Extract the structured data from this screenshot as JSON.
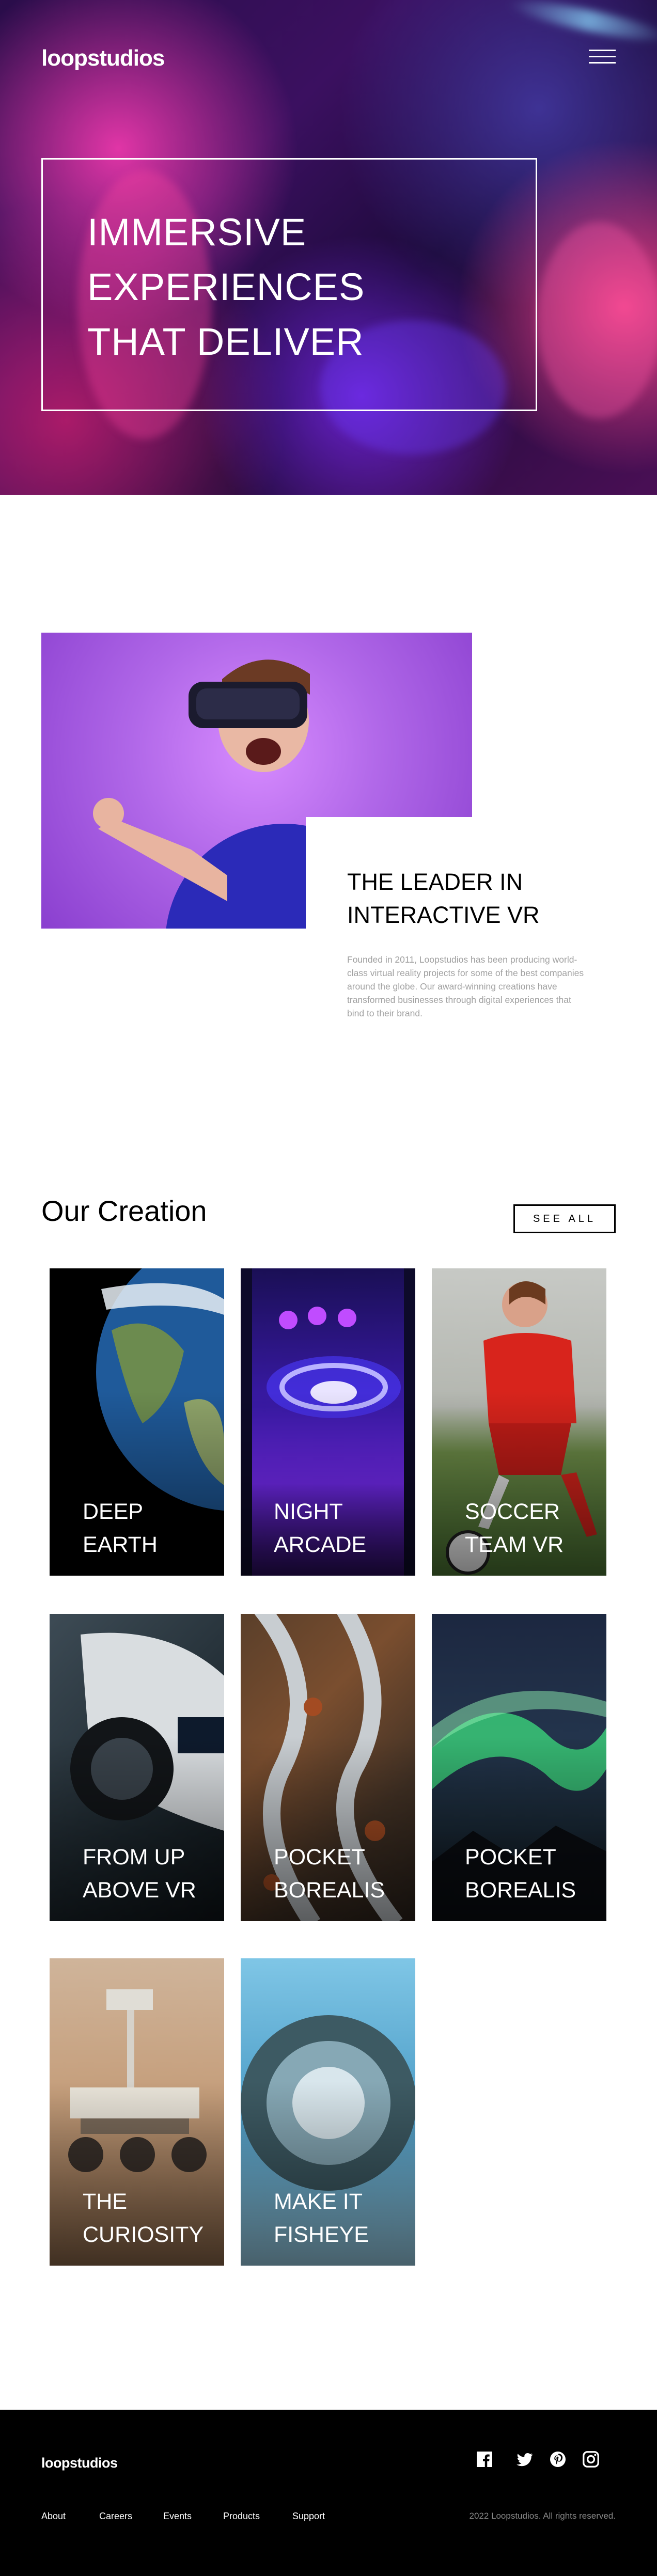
{
  "header": {
    "logo": "loopstudios",
    "menu_icon": "hamburger-menu-icon"
  },
  "hero": {
    "title": "Immersive experiences that deliver"
  },
  "interactive": {
    "title": "The leader in interactive VR",
    "text": "Founded in 2011, Loopstudios has been producing world-class virtual reality projects for some of the best companies around the globe. Our award-winning creations have transformed businesses through digital experiences that bind to their brand."
  },
  "creations": {
    "title": "Our Creation",
    "see_all": "See all",
    "items": [
      {
        "label": "Deep earth"
      },
      {
        "label": "Night arcade"
      },
      {
        "label": "Soccer team VR"
      },
      {
        "label": "From up above VR"
      },
      {
        "label": "Pocket borealis"
      },
      {
        "label": "Pocket borealis"
      },
      {
        "label": "The curiosity"
      },
      {
        "label": "Make it fisheye"
      }
    ]
  },
  "footer": {
    "logo": "loopstudios",
    "nav": [
      "About",
      "Careers",
      "Events",
      "Products",
      "Support"
    ],
    "social_icons": [
      "facebook-icon",
      "twitter-icon",
      "pinterest-icon",
      "instagram-icon"
    ],
    "copyright": "2022 Loopstudios. All rights reserved."
  },
  "colors": {
    "black": "#000000",
    "white": "#ffffff",
    "gray_text": "#a0a0a0",
    "footer_copy": "#8a8a8a"
  }
}
